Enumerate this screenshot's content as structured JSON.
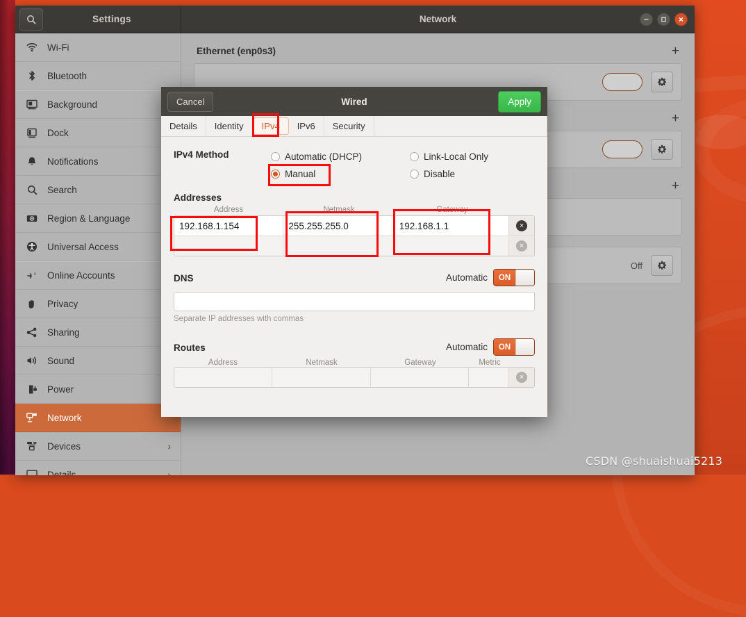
{
  "window": {
    "search_icon": "search-icon",
    "left_title": "Settings",
    "main_title": "Network",
    "buttons": {
      "minimize": "–",
      "maximize": "□",
      "close": "×"
    }
  },
  "sidebar": {
    "items": [
      {
        "label": "Wi-Fi",
        "icon": "wifi-icon",
        "active": false,
        "chevron": ""
      },
      {
        "label": "Bluetooth",
        "icon": "bluetooth-icon",
        "active": false,
        "chevron": ""
      },
      {
        "label": "Background",
        "icon": "background-icon",
        "active": false,
        "chevron": ""
      },
      {
        "label": "Dock",
        "icon": "dock-icon",
        "active": false,
        "chevron": ""
      },
      {
        "label": "Notifications",
        "icon": "bell-icon",
        "active": false,
        "chevron": ""
      },
      {
        "label": "Search",
        "icon": "search-icon",
        "active": false,
        "chevron": ""
      },
      {
        "label": "Region & Language",
        "icon": "region-language-icon",
        "active": false,
        "chevron": ""
      },
      {
        "label": "Universal Access",
        "icon": "universal-access-icon",
        "active": false,
        "chevron": ""
      },
      {
        "label": "Online Accounts",
        "icon": "online-accounts-icon",
        "active": false,
        "chevron": ""
      },
      {
        "label": "Privacy",
        "icon": "privacy-hand-icon",
        "active": false,
        "chevron": ""
      },
      {
        "label": "Sharing",
        "icon": "sharing-icon",
        "active": false,
        "chevron": ""
      },
      {
        "label": "Sound",
        "icon": "sound-icon",
        "active": false,
        "chevron": ""
      },
      {
        "label": "Power",
        "icon": "power-icon",
        "active": false,
        "chevron": ""
      },
      {
        "label": "Network",
        "icon": "network-icon",
        "active": true,
        "chevron": ""
      },
      {
        "label": "Devices",
        "icon": "devices-icon",
        "active": false,
        "chevron": "›"
      },
      {
        "label": "Details",
        "icon": "details-icon",
        "active": false,
        "chevron": "›"
      }
    ]
  },
  "network_panel": {
    "sections": [
      {
        "title": "Ethernet (enp0s3)",
        "add_label": "+",
        "gear": "gear-icon",
        "status": ""
      },
      {
        "title": "",
        "add_label": "+",
        "gear": "gear-icon",
        "status": ""
      },
      {
        "title": "",
        "add_label": "+",
        "gear": "gear-icon",
        "status": "Off"
      }
    ]
  },
  "dialog": {
    "cancel_label": "Cancel",
    "title": "Wired",
    "apply_label": "Apply",
    "tabs": [
      {
        "label": "Details",
        "active": false
      },
      {
        "label": "Identity",
        "active": false
      },
      {
        "label": "IPv4",
        "active": true
      },
      {
        "label": "IPv6",
        "active": false
      },
      {
        "label": "Security",
        "active": false
      }
    ],
    "ipv4_method": {
      "label": "IPv4 Method",
      "options": [
        {
          "label": "Automatic (DHCP)",
          "selected": false
        },
        {
          "label": "Manual",
          "selected": true
        },
        {
          "label": "Link-Local Only",
          "selected": false
        },
        {
          "label": "Disable",
          "selected": false
        }
      ]
    },
    "addresses": {
      "title": "Addresses",
      "columns": [
        "Address",
        "Netmask",
        "Gateway"
      ],
      "rows": [
        {
          "address": "192.168.1.154",
          "netmask": "255.255.255.0",
          "gateway": "192.168.1.1",
          "delete": "×"
        },
        {
          "address": "",
          "netmask": "",
          "gateway": "",
          "delete": "×"
        }
      ]
    },
    "dns": {
      "title": "DNS",
      "automatic_label": "Automatic",
      "toggle_state": "ON",
      "value": "",
      "hint": "Separate IP addresses with commas"
    },
    "routes": {
      "title": "Routes",
      "automatic_label": "Automatic",
      "toggle_state": "ON",
      "columns": [
        "Address",
        "Netmask",
        "Gateway",
        "Metric"
      ],
      "rows": [
        {
          "address": "",
          "netmask": "",
          "gateway": "",
          "metric": "",
          "delete": "×"
        }
      ]
    }
  },
  "annotations": {
    "color": "#f60c0c",
    "boxes": [
      "ipv4-tab",
      "manual-radio",
      "address-field",
      "netmask-field",
      "gateway-field"
    ]
  },
  "watermark": {
    "text": "CSDN @shuaishuai5213"
  }
}
